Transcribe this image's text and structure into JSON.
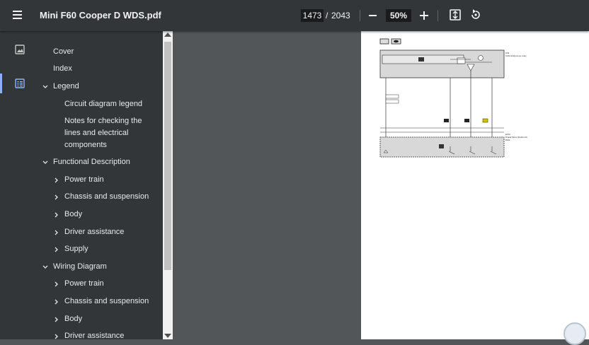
{
  "toolbar": {
    "title": "Mini F60 Cooper D WDS.pdf",
    "current_page": "1473",
    "page_separator": "/",
    "total_pages": "2043",
    "zoom": "50%"
  },
  "outline": [
    {
      "label": "Cover",
      "level": 0,
      "expander": "none"
    },
    {
      "label": "Index",
      "level": 0,
      "expander": "none"
    },
    {
      "label": "Legend",
      "level": 0,
      "expander": "expanded"
    },
    {
      "label": "Circuit diagram legend",
      "level": 1,
      "expander": "none"
    },
    {
      "label": "Notes for checking the",
      "label2": "lines and electrical",
      "label3": "components",
      "level": 1,
      "expander": "none"
    },
    {
      "label": "Functional Description",
      "level": 0,
      "expander": "expanded"
    },
    {
      "label": "Power train",
      "level": 1,
      "expander": "collapsed"
    },
    {
      "label": "Chassis and suspension",
      "level": 1,
      "expander": "collapsed"
    },
    {
      "label": "Body",
      "level": 1,
      "expander": "collapsed"
    },
    {
      "label": "Driver assistance",
      "level": 1,
      "expander": "collapsed"
    },
    {
      "label": "Supply",
      "level": 1,
      "expander": "collapsed"
    },
    {
      "label": "Wiring Diagram",
      "level": 0,
      "expander": "expanded"
    },
    {
      "label": "Power train",
      "level": 1,
      "expander": "collapsed"
    },
    {
      "label": "Chassis and suspension",
      "level": 1,
      "expander": "collapsed"
    },
    {
      "label": "Body",
      "level": 1,
      "expander": "collapsed"
    },
    {
      "label": "Driver assistance",
      "level": 1,
      "expander": "collapsed"
    }
  ],
  "diagram": {
    "label_a1": "K94",
    "label_a2": "Kühlmittelpumpe relay",
    "label_b1": "ECM",
    "label_b2": "Digital Motor Elektronik",
    "label_b3": "DDE"
  },
  "colors": {
    "toolbar_bg": "#323639",
    "viewer_bg": "#525659",
    "accent": "#8ab4f8"
  }
}
